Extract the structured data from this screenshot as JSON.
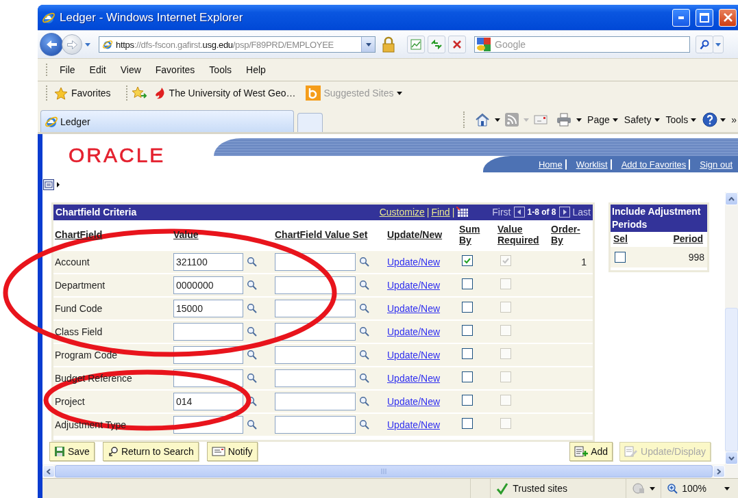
{
  "window": {
    "title": "Ledger - Windows Internet Explorer"
  },
  "address_bar": {
    "url_parts": [
      {
        "text": "https",
        "kind": "strong"
      },
      {
        "text": "://dfs-fscon.gafirst.",
        "kind": "dim"
      },
      {
        "text": "usg.edu",
        "kind": "strong"
      },
      {
        "text": "/psp/F89PRD/EMPLOYEE",
        "kind": "dim"
      }
    ]
  },
  "search_box": {
    "placeholder": "Google"
  },
  "menu_bar": [
    {
      "label": "File"
    },
    {
      "label": "Edit"
    },
    {
      "label": "View"
    },
    {
      "label": "Favorites"
    },
    {
      "label": "Tools"
    },
    {
      "label": "Help"
    }
  ],
  "favorites_bar": {
    "favorites": "Favorites",
    "links": [
      {
        "label": "The University of West Geo…",
        "kind": "site"
      },
      {
        "label": "Suggested Sites",
        "kind": "gallery"
      }
    ]
  },
  "tabs": [
    {
      "label": "Ledger",
      "selected": true
    }
  ],
  "command_bar": [
    {
      "label": "Page"
    },
    {
      "label": "Safety"
    },
    {
      "label": "Tools"
    }
  ],
  "command_more": "»",
  "logo": "ORACLE",
  "header_links": [
    "Home",
    "Worklist",
    "Add to Favorites",
    "Sign out"
  ],
  "grid": {
    "title": "Chartfield Criteria",
    "links": [
      "Customize",
      "Find"
    ],
    "link_separators": [
      "|",
      "|"
    ],
    "nav": {
      "first": "First",
      "range": "1-8 of 8",
      "last": "Last"
    },
    "columns": [
      "ChartField",
      "Value",
      "ChartField Value Set",
      "Update/New",
      "Sum By",
      "Value Required",
      "Order-By"
    ],
    "rows": [
      {
        "chartfield": "Account",
        "value": "321100",
        "link": "Update/New",
        "sum_by": true,
        "value_required": true,
        "order_by": "1"
      },
      {
        "chartfield": "Department",
        "value": "0000000",
        "link": "Update/New",
        "sum_by": false,
        "value_required": false
      },
      {
        "chartfield": "Fund Code",
        "value": "15000",
        "link": "Update/New",
        "sum_by": false,
        "value_required": false
      },
      {
        "chartfield": "Class Field",
        "link": "Update/New",
        "sum_by": false,
        "value_required": false
      },
      {
        "chartfield": "Program Code",
        "link": "Update/New",
        "sum_by": false,
        "value_required": false
      },
      {
        "chartfield": "Budget Reference",
        "link": "Update/New",
        "sum_by": false,
        "value_required": false
      },
      {
        "chartfield": "Project",
        "value": "014",
        "link": "Update/New",
        "sum_by": false,
        "value_required": false
      },
      {
        "chartfield": "Adjustment Type",
        "link": "Update/New",
        "sum_by": false,
        "value_required": false
      }
    ]
  },
  "adjustment_periods": {
    "title": "Include Adjustment Periods",
    "columns": [
      "Sel",
      "Period"
    ],
    "rows": [
      {
        "checked": false,
        "period": "998"
      }
    ]
  },
  "page_buttons": [
    {
      "label": "Save",
      "kind": "save",
      "disabled": false
    },
    {
      "label": "Return to Search",
      "kind": "return",
      "disabled": false
    },
    {
      "label": "Notify",
      "kind": "notify",
      "disabled": false
    }
  ],
  "action_buttons": [
    {
      "label": "Add",
      "kind": "add",
      "disabled": false
    },
    {
      "label": "Update/Display",
      "kind": "update",
      "disabled": true
    }
  ],
  "status_bar": {
    "zone": "Trusted sites",
    "zoom": "100%"
  },
  "annotations": [
    {
      "kind": "ellipse",
      "color": "#e8141c"
    },
    {
      "kind": "ellipse",
      "color": "#e8141c"
    }
  ]
}
